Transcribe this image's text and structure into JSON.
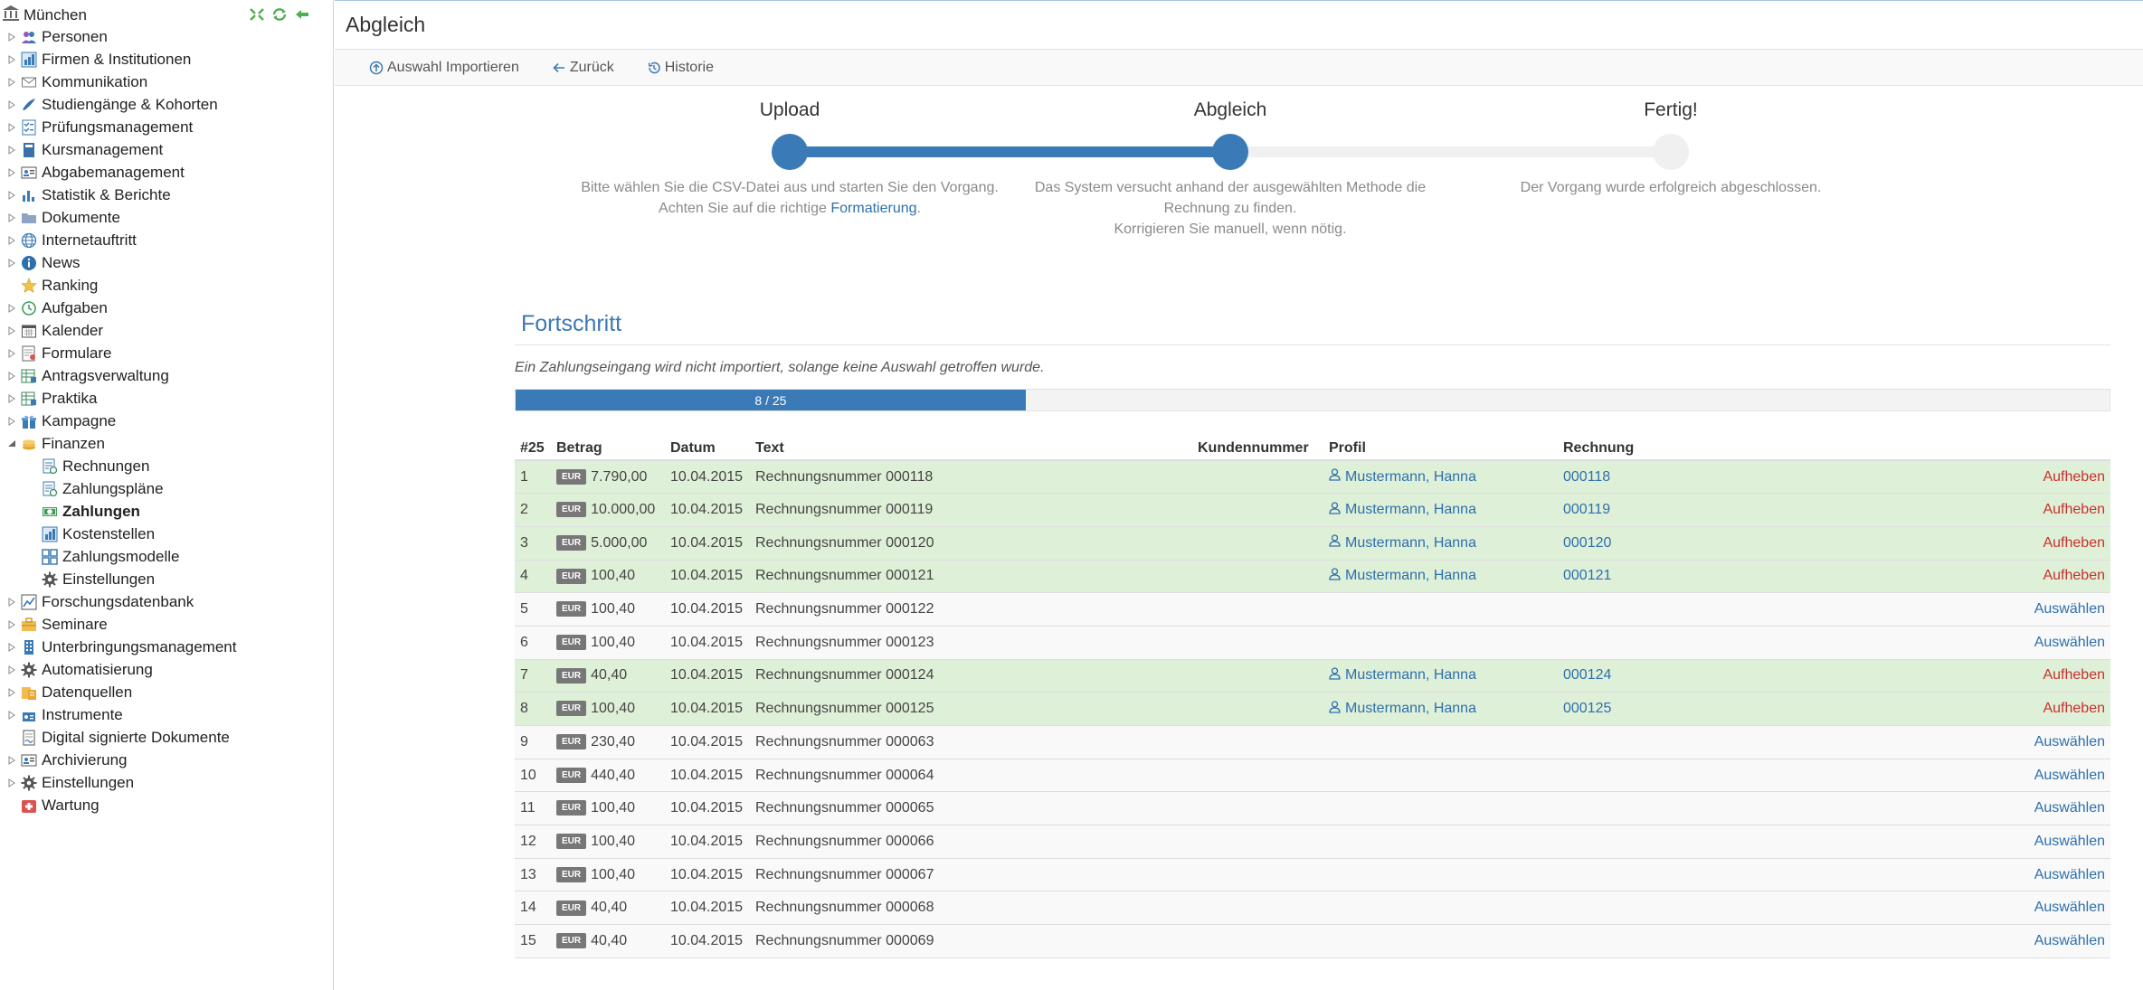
{
  "sidebar": {
    "root": {
      "label": "München",
      "icon": "museum-icon"
    },
    "items": [
      {
        "label": "Personen",
        "icon": "people-icon",
        "child": false
      },
      {
        "label": "Firmen & Institutionen",
        "icon": "factory-chart-icon",
        "child": false
      },
      {
        "label": "Kommunikation",
        "icon": "envelope-icon",
        "child": false
      },
      {
        "label": "Studiengänge & Kohorten",
        "icon": "graduation-cap-icon",
        "child": false
      },
      {
        "label": "Prüfungsmanagement",
        "icon": "checklist-icon",
        "child": false
      },
      {
        "label": "Kursmanagement",
        "icon": "book-icon",
        "child": false
      },
      {
        "label": "Abgabemanagement",
        "icon": "id-card-icon",
        "child": false
      },
      {
        "label": "Statistik & Berichte",
        "icon": "bar-chart-icon",
        "child": false
      },
      {
        "label": "Dokumente",
        "icon": "folder-icon",
        "child": false
      },
      {
        "label": "Internetauftritt",
        "icon": "globe-icon",
        "child": false
      },
      {
        "label": "News",
        "icon": "info-icon",
        "child": false
      },
      {
        "label": "Ranking",
        "icon": "star-icon",
        "child": false,
        "noexp": true
      },
      {
        "label": "Aufgaben",
        "icon": "clock-icon",
        "child": false
      },
      {
        "label": "Kalender",
        "icon": "calendar-icon",
        "child": false
      },
      {
        "label": "Formulare",
        "icon": "form-icon",
        "child": false
      },
      {
        "label": "Antragsverwaltung",
        "icon": "table-edit-icon",
        "child": false
      },
      {
        "label": "Praktika",
        "icon": "table-edit-icon",
        "child": false
      },
      {
        "label": "Kampagne",
        "icon": "gift-icon",
        "child": false
      },
      {
        "label": "Finanzen",
        "icon": "coins-icon",
        "child": false,
        "expanded": true
      },
      {
        "label": "Rechnungen",
        "icon": "invoice-icon",
        "child": true
      },
      {
        "label": "Zahlungspläne",
        "icon": "invoice-icon",
        "child": true
      },
      {
        "label": "Zahlungen",
        "icon": "banknote-icon",
        "child": true,
        "bold": true
      },
      {
        "label": "Kostenstellen",
        "icon": "factory-chart-icon",
        "child": true
      },
      {
        "label": "Zahlungsmodelle",
        "icon": "grid-icon",
        "child": true
      },
      {
        "label": "Einstellungen",
        "icon": "gear-icon",
        "child": true
      },
      {
        "label": "Forschungsdatenbank",
        "icon": "line-chart-icon",
        "child": false
      },
      {
        "label": "Seminare",
        "icon": "briefcase-icon",
        "child": false
      },
      {
        "label": "Unterbringungsmanagement",
        "icon": "building-icon",
        "child": false
      },
      {
        "label": "Automatisierung",
        "icon": "gear-icon",
        "child": false
      },
      {
        "label": "Datenquellen",
        "icon": "database-icon",
        "child": false
      },
      {
        "label": "Instrumente",
        "icon": "instrument-icon",
        "child": false
      },
      {
        "label": "Digital signierte Dokumente",
        "icon": "signed-doc-icon",
        "child": false,
        "noexp": true
      },
      {
        "label": "Archivierung",
        "icon": "id-card-icon",
        "child": false
      },
      {
        "label": "Einstellungen",
        "icon": "gear-icon",
        "child": false
      },
      {
        "label": "Wartung",
        "icon": "first-aid-icon",
        "child": false,
        "noexp": true
      }
    ]
  },
  "header": {
    "title": "Abgleich"
  },
  "toolbar": {
    "import_label": "Auswahl Importieren",
    "back_label": "Zurück",
    "history_label": "Historie"
  },
  "stepper": {
    "steps": [
      {
        "title": "Upload",
        "desc1": "Bitte wählen Sie die CSV-Datei aus und starten Sie den Vorgang.",
        "desc2": "Achten Sie auf die richtige ",
        "link": "Formatierung",
        "desc3": "."
      },
      {
        "title": "Abgleich",
        "desc1": "Das System versucht anhand der ausgewählten Methode die",
        "desc2": "Rechnung zu finden.",
        "desc3": "Korrigieren Sie manuell, wenn nötig."
      },
      {
        "title": "Fertig!",
        "desc1": "Der Vorgang wurde erfolgreich abgeschlossen."
      }
    ],
    "current_step": 2
  },
  "progress": {
    "title": "Fortschritt",
    "note": "Ein Zahlungseingang wird nicht importiert, solange keine Auswahl getroffen wurde.",
    "label": "8 / 25",
    "done": 8,
    "total": 25
  },
  "table": {
    "headers": {
      "num": "#25",
      "amount": "Betrag",
      "date": "Datum",
      "text": "Text",
      "customer": "Kundennummer",
      "profile": "Profil",
      "invoice": "Rechnung"
    },
    "currency": "EUR",
    "action_remove": "Aufheben",
    "action_select": "Auswählen",
    "rows": [
      {
        "n": "1",
        "amount": "7.790,00",
        "date": "10.04.2015",
        "text": "Rechnungsnummer 000118",
        "profile": "Mustermann, Hanna",
        "invoice": "000118",
        "selected": true
      },
      {
        "n": "2",
        "amount": "10.000,00",
        "date": "10.04.2015",
        "text": "Rechnungsnummer 000119",
        "profile": "Mustermann, Hanna",
        "invoice": "000119",
        "selected": true
      },
      {
        "n": "3",
        "amount": "5.000,00",
        "date": "10.04.2015",
        "text": "Rechnungsnummer 000120",
        "profile": "Mustermann, Hanna",
        "invoice": "000120",
        "selected": true
      },
      {
        "n": "4",
        "amount": "100,40",
        "date": "10.04.2015",
        "text": "Rechnungsnummer 000121",
        "profile": "Mustermann, Hanna",
        "invoice": "000121",
        "selected": true
      },
      {
        "n": "5",
        "amount": "100,40",
        "date": "10.04.2015",
        "text": "Rechnungsnummer 000122",
        "profile": "",
        "invoice": "",
        "selected": false
      },
      {
        "n": "6",
        "amount": "100,40",
        "date": "10.04.2015",
        "text": "Rechnungsnummer 000123",
        "profile": "",
        "invoice": "",
        "selected": false
      },
      {
        "n": "7",
        "amount": "40,40",
        "date": "10.04.2015",
        "text": "Rechnungsnummer 000124",
        "profile": "Mustermann, Hanna",
        "invoice": "000124",
        "selected": true
      },
      {
        "n": "8",
        "amount": "100,40",
        "date": "10.04.2015",
        "text": "Rechnungsnummer 000125",
        "profile": "Mustermann, Hanna",
        "invoice": "000125",
        "selected": true
      },
      {
        "n": "9",
        "amount": "230,40",
        "date": "10.04.2015",
        "text": "Rechnungsnummer 000063",
        "profile": "",
        "invoice": "",
        "selected": false
      },
      {
        "n": "10",
        "amount": "440,40",
        "date": "10.04.2015",
        "text": "Rechnungsnummer 000064",
        "profile": "",
        "invoice": "",
        "selected": false
      },
      {
        "n": "11",
        "amount": "100,40",
        "date": "10.04.2015",
        "text": "Rechnungsnummer 000065",
        "profile": "",
        "invoice": "",
        "selected": false
      },
      {
        "n": "12",
        "amount": "100,40",
        "date": "10.04.2015",
        "text": "Rechnungsnummer 000066",
        "profile": "",
        "invoice": "",
        "selected": false
      },
      {
        "n": "13",
        "amount": "100,40",
        "date": "10.04.2015",
        "text": "Rechnungsnummer 000067",
        "profile": "",
        "invoice": "",
        "selected": false
      },
      {
        "n": "14",
        "amount": "40,40",
        "date": "10.04.2015",
        "text": "Rechnungsnummer 000068",
        "profile": "",
        "invoice": "",
        "selected": false
      },
      {
        "n": "15",
        "amount": "40,40",
        "date": "10.04.2015",
        "text": "Rechnungsnummer 000069",
        "profile": "",
        "invoice": "",
        "selected": false
      }
    ]
  }
}
